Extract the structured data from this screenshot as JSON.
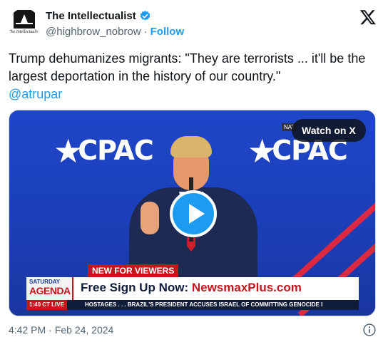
{
  "account": {
    "display_name": "The Intellectualist",
    "handle": "@highbrow_nobrow",
    "separator": "·",
    "follow_label": "Follow",
    "avatar_wordmark": "The Intellectualist",
    "verified_icon": "verified-badge-icon"
  },
  "tweet": {
    "text": "Trump dehumanizes migrants: \"They are terrorists ... it'll be the largest deportation in the history of our country.\"",
    "mention": "@atrupar"
  },
  "video": {
    "watch_label": "Watch on X",
    "play_icon": "play-icon",
    "stage_text_left": "CPAC",
    "stage_text_right": "CPAC",
    "corner_badge": "NAT",
    "chyron": {
      "tag": "NEW FOR VIEWERS",
      "show_line1": "SATURDAY",
      "show_line2": "AGENDA",
      "headline_prefix": "Free Sign Up Now: ",
      "headline_brand": "NewsmaxPlus.com",
      "ticker_time": "1:40 CT  LIVE",
      "ticker_text": "HOSTAGES . . .      BRAZIL'S PRESIDENT ACCUSES ISRAEL OF COMMITTING GENOCIDE I"
    }
  },
  "footer": {
    "time": "4:42 PM",
    "separator": "·",
    "date": "Feb 24, 2024",
    "info_icon": "info-icon"
  },
  "colors": {
    "accent": "#1d9bf0",
    "text": "#0f1419",
    "muted": "#536471",
    "chyron_red": "#c4161c",
    "stage_blue": "#1f46c9"
  }
}
